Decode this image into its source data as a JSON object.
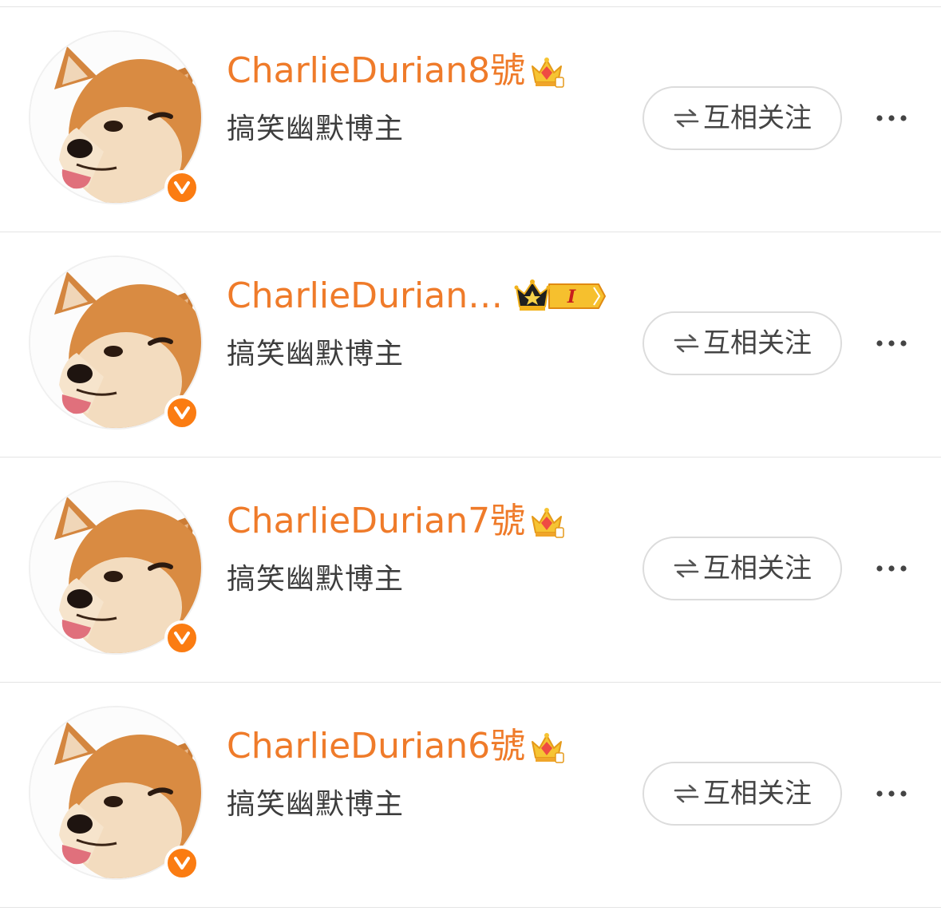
{
  "follow_list": {
    "items": [
      {
        "username": "CharlieDurian8號",
        "subtitle": "搞笑幽默博主",
        "badge": "crown-gem-icon",
        "follow_label": "互相关注"
      },
      {
        "username": "CharlieDurian…",
        "subtitle": "搞笑幽默博主",
        "badge": "crown-level-icon",
        "badge_text": "I",
        "follow_label": "互相关注"
      },
      {
        "username": "CharlieDurian7號",
        "subtitle": "搞笑幽默博主",
        "badge": "crown-gem-icon",
        "follow_label": "互相关注"
      },
      {
        "username": "CharlieDurian6號",
        "subtitle": "搞笑幽默博主",
        "badge": "crown-gem-icon",
        "follow_label": "互相关注"
      }
    ]
  },
  "icons": {
    "verified": "verified-v-icon",
    "swap": "swap-arrows-icon",
    "more": "more-dots-icon"
  },
  "colors": {
    "username": "#ef7b2a",
    "verified_badge": "#fb7c12",
    "subtitle": "#3d3d3d",
    "button_border": "#dcdcdc",
    "divider": "#e4e4e4"
  }
}
